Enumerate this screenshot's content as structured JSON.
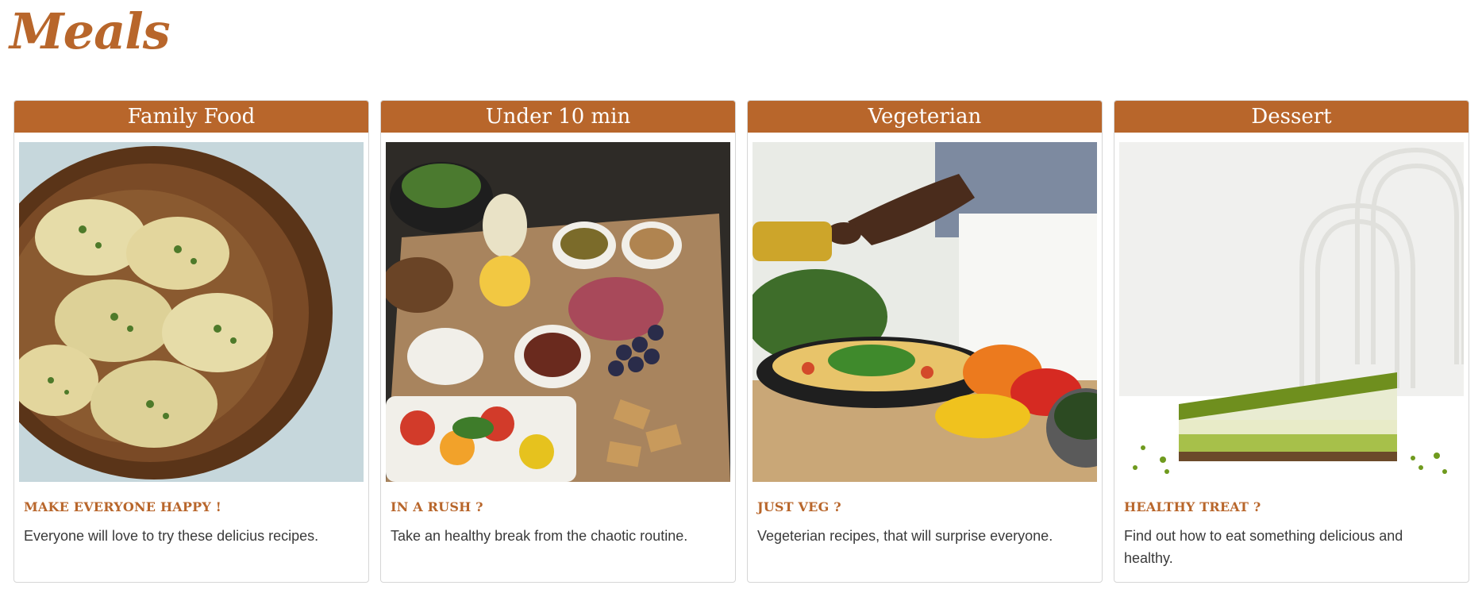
{
  "app": {
    "logo_text": "Meals",
    "brand_color": "#b8662b"
  },
  "cards": [
    {
      "title": "Family Food",
      "subtitle": "MAKE EVERYONE HAPPY !",
      "text": "Everyone will love to try these delicius recipes.",
      "image_desc": "ravioli-in-wooden-bowl"
    },
    {
      "title": "Under 10 min",
      "subtitle": "IN A RUSH ?",
      "text": "Take an healthy break from the chaotic routine.",
      "image_desc": "charcuterie-board"
    },
    {
      "title": "Vegeterian",
      "subtitle": "JUST VEG ?",
      "text": "Vegeterian recipes, that will surprise everyone.",
      "image_desc": "pouring-olive-oil-on-veg-pan"
    },
    {
      "title": "Dessert",
      "subtitle": "HEALTHY TREAT ?",
      "text": "Find out how to eat something delicious and healthy.",
      "image_desc": "matcha-cake-slice"
    }
  ]
}
